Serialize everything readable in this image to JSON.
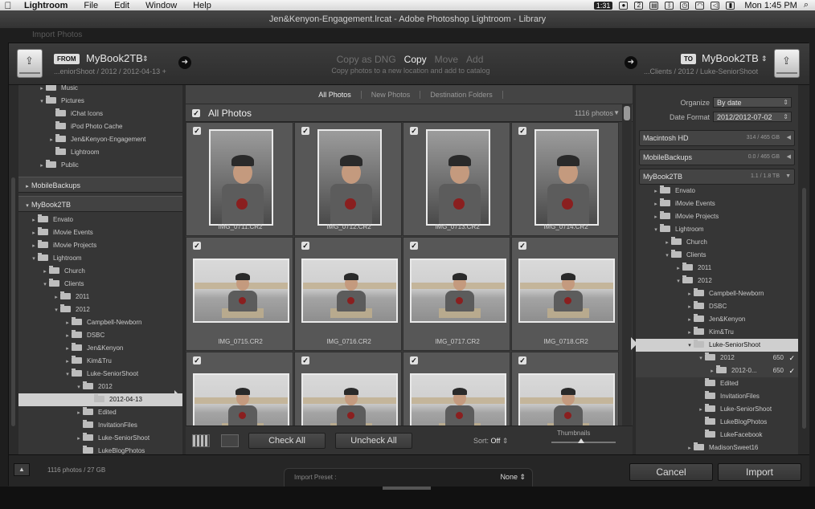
{
  "menubar": {
    "app": "Lightroom",
    "items": [
      "File",
      "Edit",
      "Window",
      "Help"
    ],
    "badge": "1:31",
    "clock": "Mon 1:45 PM"
  },
  "window": {
    "title": "Jen&Kenyon-Engagement.lrcat - Adobe Photoshop Lightroom - Library"
  },
  "background_label": "Import Photos",
  "source": {
    "tag": "FROM",
    "name": "MyBook2TB",
    "path": "...eniorShoot / 2012 / 2012-04-13 +"
  },
  "destination": {
    "tag": "TO",
    "name": "MyBook2TB",
    "path": "...Clients / 2012 / Luke-SeniorShoot"
  },
  "modes": {
    "items": [
      "Copy as DNG",
      "Copy",
      "Move",
      "Add"
    ],
    "active": "Copy",
    "description": "Copy photos to a new location and add to catalog"
  },
  "left_tree": {
    "top_rows": [
      {
        "label": "Music",
        "indent": 2,
        "tri": "▸"
      },
      {
        "label": "Pictures",
        "indent": 2,
        "tri": "▾"
      },
      {
        "label": "iChat Icons",
        "indent": 3,
        "tri": ""
      },
      {
        "label": "iPod Photo Cache",
        "indent": 3,
        "tri": ""
      },
      {
        "label": "Jen&Kenyon-Engagement",
        "indent": 3,
        "tri": "▸"
      },
      {
        "label": "Lightroom",
        "indent": 3,
        "tri": ""
      },
      {
        "label": "Public",
        "indent": 2,
        "tri": "▸"
      }
    ],
    "sections": [
      "MobileBackups",
      "MyBook2TB"
    ],
    "book_rows": [
      {
        "label": "Envato",
        "indent": 1,
        "tri": "▸"
      },
      {
        "label": "iMovie Events",
        "indent": 1,
        "tri": "▸"
      },
      {
        "label": "iMovie Projects",
        "indent": 1,
        "tri": "▸"
      },
      {
        "label": "Lightroom",
        "indent": 1,
        "tri": "▾"
      },
      {
        "label": "Church",
        "indent": 2,
        "tri": "▸"
      },
      {
        "label": "Clients",
        "indent": 2,
        "tri": "▾"
      },
      {
        "label": "2011",
        "indent": 3,
        "tri": "▸"
      },
      {
        "label": "2012",
        "indent": 3,
        "tri": "▾"
      },
      {
        "label": "Campbell-Newborn",
        "indent": 4,
        "tri": "▸"
      },
      {
        "label": "DSBC",
        "indent": 4,
        "tri": "▸"
      },
      {
        "label": "Jen&Kenyon",
        "indent": 4,
        "tri": "▸"
      },
      {
        "label": "Kim&Tru",
        "indent": 4,
        "tri": "▸"
      },
      {
        "label": "Luke-SeniorShoot",
        "indent": 4,
        "tri": "▾"
      },
      {
        "label": "2012",
        "indent": 5,
        "tri": "▾"
      },
      {
        "label": "2012-04-13",
        "indent": 6,
        "tri": "",
        "selected": true
      },
      {
        "label": "Edited",
        "indent": 5,
        "tri": "▸"
      },
      {
        "label": "InvitationFiles",
        "indent": 5,
        "tri": ""
      },
      {
        "label": "Luke-SeniorShoot",
        "indent": 5,
        "tri": "▸"
      },
      {
        "label": "LukeBlogPhotos",
        "indent": 5,
        "tri": ""
      }
    ]
  },
  "grid": {
    "tabs": [
      "All Photos",
      "New Photos",
      "Destination Folders"
    ],
    "active_tab": "All Photos",
    "header": "All Photos",
    "count": "1116 photos",
    "photos": [
      {
        "name": "IMG_0711.CR2",
        "orient": "portrait"
      },
      {
        "name": "IMG_0712.CR2",
        "orient": "portrait"
      },
      {
        "name": "IMG_0713.CR2",
        "orient": "portrait"
      },
      {
        "name": "IMG_0714.CR2",
        "orient": "portrait"
      },
      {
        "name": "IMG_0715.CR2",
        "orient": "land"
      },
      {
        "name": "IMG_0716.CR2",
        "orient": "land"
      },
      {
        "name": "IMG_0717.CR2",
        "orient": "land"
      },
      {
        "name": "IMG_0718.CR2",
        "orient": "land"
      },
      {
        "name": "",
        "orient": "land"
      },
      {
        "name": "",
        "orient": "land"
      },
      {
        "name": "",
        "orient": "land"
      },
      {
        "name": "",
        "orient": "land"
      }
    ],
    "check_all": "Check All",
    "uncheck_all": "Uncheck All",
    "sort_label": "Sort:",
    "sort_value": "Off",
    "thumbnails_label": "Thumbnails",
    "thumbnail_size": 0.43
  },
  "right": {
    "organize_label": "Organize",
    "organize_value": "By date",
    "date_format_label": "Date Format",
    "date_format_value": "2012/2012-07-02",
    "volumes": [
      {
        "name": "Macintosh HD",
        "cap": "314 / 465 GB"
      },
      {
        "name": "MobileBackups",
        "cap": "0.0 / 465 GB"
      },
      {
        "name": "MyBook2TB",
        "cap": "1.1 / 1.8 TB"
      }
    ],
    "tree": [
      {
        "label": "Envato",
        "indent": 1,
        "tri": "▸"
      },
      {
        "label": "iMovie Events",
        "indent": 1,
        "tri": "▸"
      },
      {
        "label": "iMovie Projects",
        "indent": 1,
        "tri": "▸"
      },
      {
        "label": "Lightroom",
        "indent": 1,
        "tri": "▾"
      },
      {
        "label": "Church",
        "indent": 2,
        "tri": "▸"
      },
      {
        "label": "Clients",
        "indent": 2,
        "tri": "▾"
      },
      {
        "label": "2011",
        "indent": 3,
        "tri": "▸"
      },
      {
        "label": "2012",
        "indent": 3,
        "tri": "▾"
      },
      {
        "label": "Campbell-Newborn",
        "indent": 4,
        "tri": "▸"
      },
      {
        "label": "DSBC",
        "indent": 4,
        "tri": "▸"
      },
      {
        "label": "Jen&Kenyon",
        "indent": 4,
        "tri": "▸"
      },
      {
        "label": "Kim&Tru",
        "indent": 4,
        "tri": "▸"
      },
      {
        "label": "Luke-SeniorShoot",
        "indent": 4,
        "tri": "▾",
        "selected": true
      },
      {
        "label": "2012",
        "indent": 5,
        "tri": "▾",
        "new": true,
        "n": "650",
        "ck": "✓"
      },
      {
        "label": "2012-0...",
        "indent": 6,
        "tri": "▸",
        "new": true,
        "n": "650",
        "ck": "✓"
      },
      {
        "label": "Edited",
        "indent": 5,
        "tri": ""
      },
      {
        "label": "InvitationFiles",
        "indent": 5,
        "tri": ""
      },
      {
        "label": "Luke-SeniorShoot",
        "indent": 5,
        "tri": "▸"
      },
      {
        "label": "LukeBlogPhotos",
        "indent": 5,
        "tri": ""
      },
      {
        "label": "LukeFacebook",
        "indent": 5,
        "tri": ""
      },
      {
        "label": "MadisonSweet16",
        "indent": 4,
        "tri": "▸"
      }
    ]
  },
  "bottom": {
    "status": "1116 photos / 27 GB",
    "preset_label": "Import Preset :",
    "preset_value": "None",
    "cancel": "Cancel",
    "import": "Import"
  }
}
